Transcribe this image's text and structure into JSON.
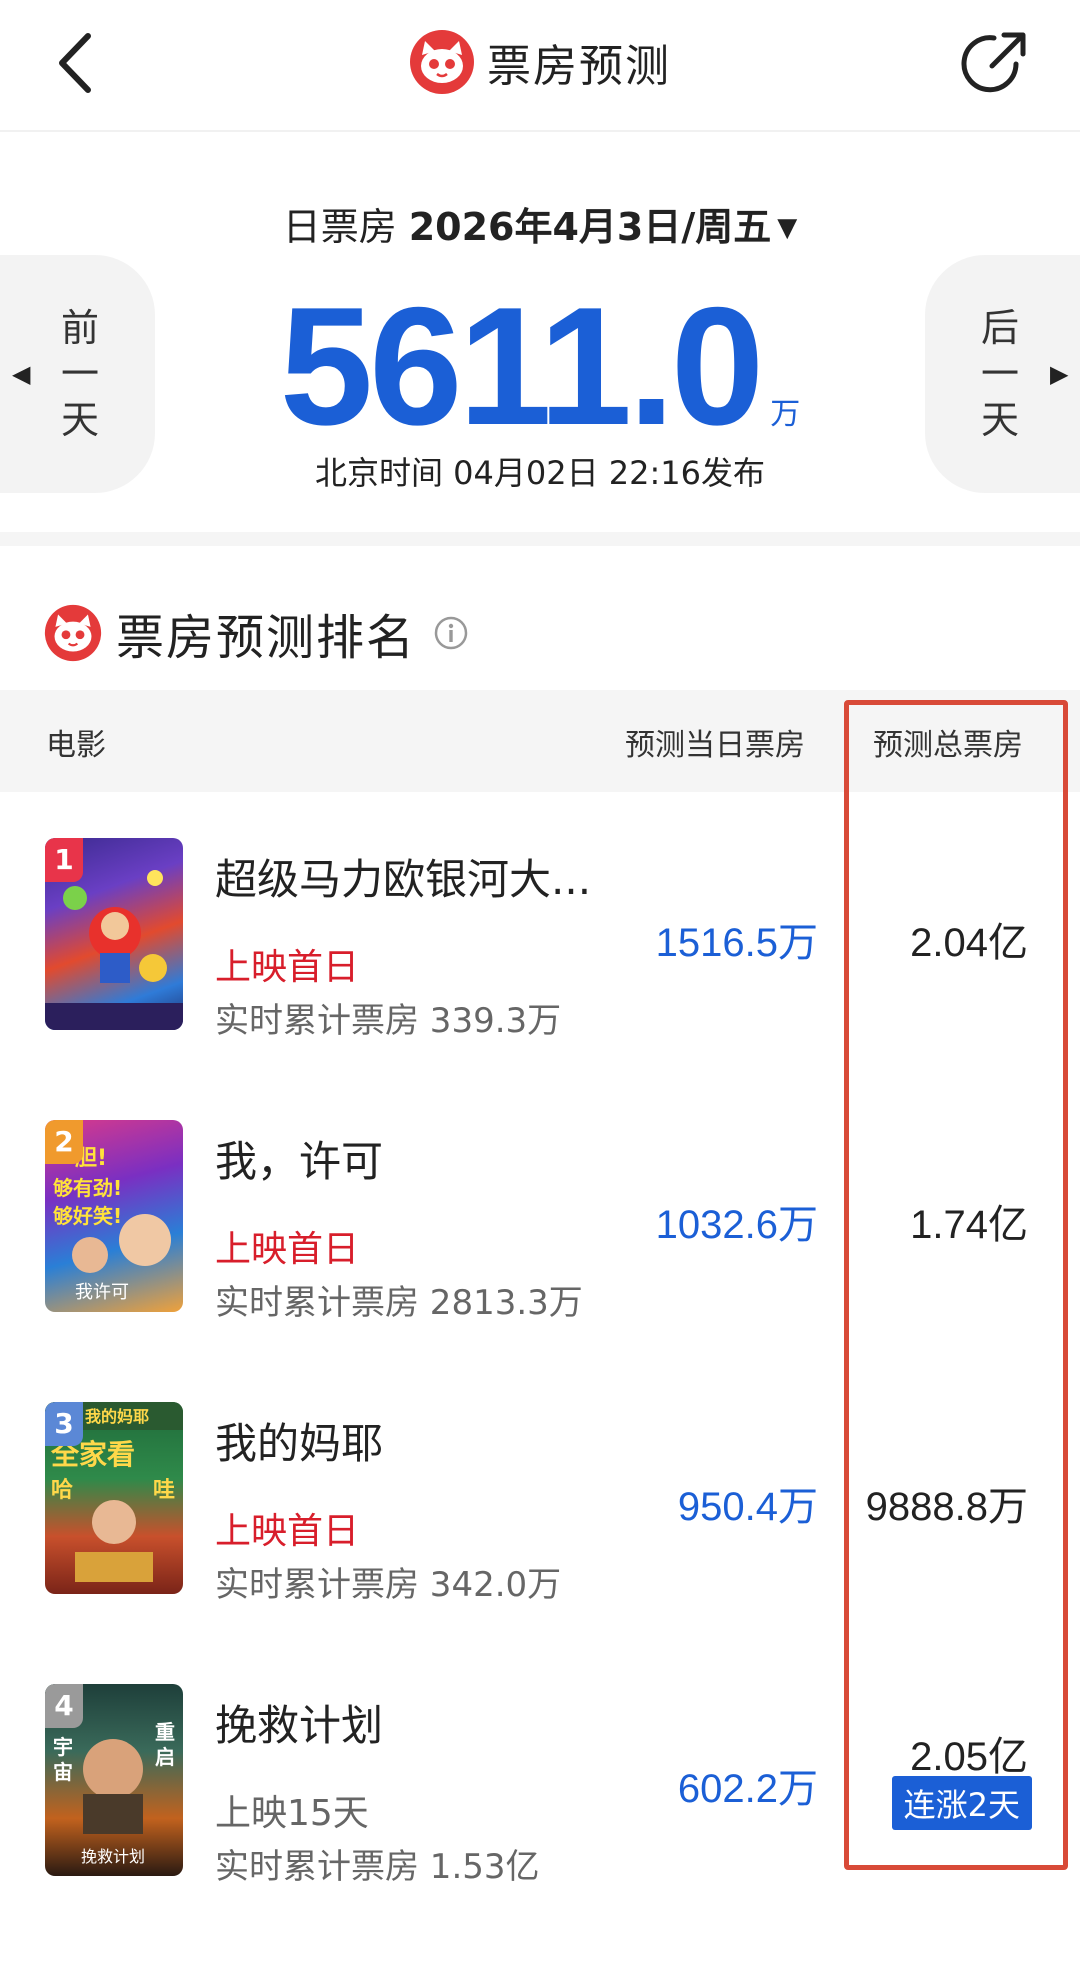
{
  "header": {
    "title": "票房预测"
  },
  "daily": {
    "label": "日票房",
    "date": "2026年4月3日/周五",
    "prev_label": "前一天",
    "next_label": "后一天",
    "value": "5611.0",
    "unit": "万",
    "publish": "北京时间  04月02日  22:16发布"
  },
  "ranking": {
    "title": "票房预测排名",
    "columns": {
      "movie": "电影",
      "today": "预测当日票房",
      "total": "预测总票房"
    },
    "rows": [
      {
        "rank": "1",
        "title": "超级马力欧银河大...",
        "status": "上映首日",
        "cumulative": "实时累计票房 339.3万",
        "today": "1516.5万",
        "total": "2.04亿",
        "badge_color": "#e8344a",
        "streak": ""
      },
      {
        "rank": "2",
        "title": "我，许可",
        "status": "上映首日",
        "cumulative": "实时累计票房 2813.3万",
        "today": "1032.6万",
        "total": "1.74亿",
        "badge_color": "#f09a2d",
        "streak": ""
      },
      {
        "rank": "3",
        "title": "我的妈耶",
        "status": "上映首日",
        "cumulative": "实时累计票房 342.0万",
        "today": "950.4万",
        "total": "9888.8万",
        "badge_color": "#5b88d6",
        "streak": ""
      },
      {
        "rank": "4",
        "title": "挽救计划",
        "status": "上映15天",
        "cumulative": "实时累计票房 1.53亿",
        "today": "602.2万",
        "total": "2.05亿",
        "badge_color": "#9a9a9a",
        "streak": "连涨2天"
      }
    ]
  },
  "colors": {
    "accent_blue": "#1b5fd6",
    "accent_red": "#d81e2b",
    "highlight": "#d84a38"
  }
}
